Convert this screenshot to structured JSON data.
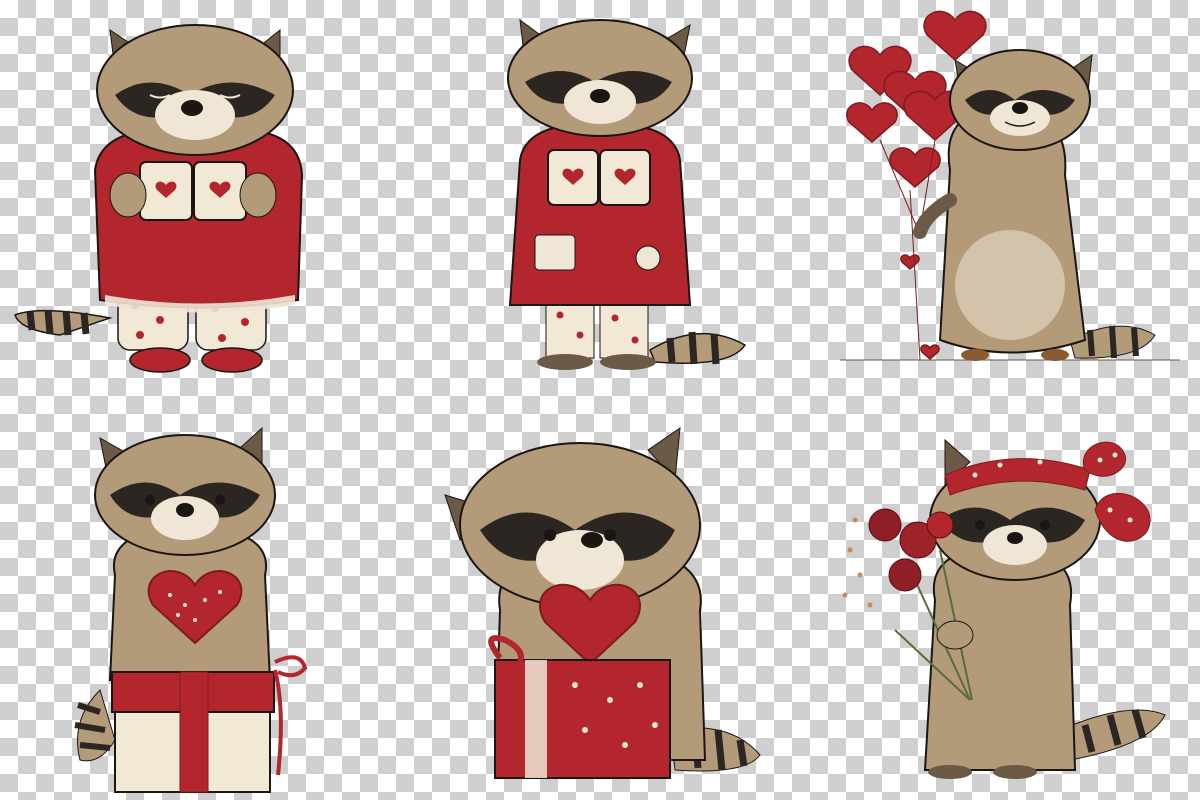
{
  "canvas": {
    "background": "transparency-checkerboard",
    "checker_light": "#ffffff",
    "checker_dark": "#cfcfcf"
  },
  "palette": {
    "fur": "#b39a78",
    "fur_dark": "#6b5a45",
    "mask": "#2c2622",
    "muzzle": "#efe6d6",
    "red": "#b3262e",
    "red_dark": "#7e1a20",
    "cream": "#f1e8d6",
    "ink": "#1b1613"
  },
  "illustrations": [
    {
      "id": 1,
      "subject": "raccoon-in-red-robe-holding-two-heart-mugs",
      "eyes": "closed"
    },
    {
      "id": 2,
      "subject": "raccoon-in-red-coat-holding-two-heart-mugs",
      "eyes": "closed"
    },
    {
      "id": 3,
      "subject": "smiling-raccoon-holding-heart-balloons",
      "eyes": "closed"
    },
    {
      "id": 4,
      "subject": "raccoon-sitting-on-gift-box-holding-dotted-heart",
      "eyes": "open"
    },
    {
      "id": 5,
      "subject": "raccoon-hugging-heart-on-red-gift-box",
      "eyes": "open"
    },
    {
      "id": 6,
      "subject": "raccoon-with-polka-dot-bow-holding-roses",
      "eyes": "open"
    }
  ]
}
